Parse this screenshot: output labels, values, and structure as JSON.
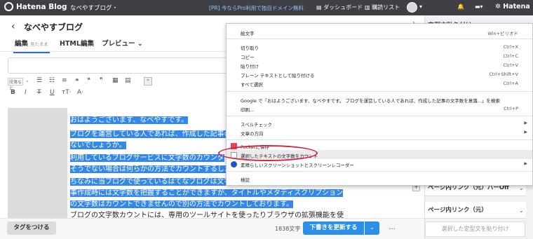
{
  "topbar": {
    "logo": "Hatena Blog",
    "blog_menu": "なべやすブログ・",
    "promo": "[PR] 今ならPro利用で独自ドメイン無料",
    "dashboard": "ダッシュボード",
    "reading_list": "購読リスト",
    "hatena": "Hatena"
  },
  "editor": {
    "blog_title": "なべやすブログ",
    "tabs": [
      {
        "label": "編集",
        "sub": "見たまま"
      },
      {
        "label": "HTML編集"
      },
      {
        "label": "プレビュー ⌄"
      }
    ],
    "font_size_label": "段落など"
  },
  "content": {
    "lines": [
      "おはようございます、なべやすです。",
      "ブログを運営している人であれば、作成した記事の文",
      "ないでしょうか。",
      "利用しているブログサービスに文字数のカウンタ",
      "そうでない場合は何らかの方法でカウントするしか",
      "ちなみに当ブログで使っているはてなブログは文字",
      "事作成時には文字数を把握することができますが、タイトルやメタディスクリプション",
      "の文字数はカウントできませんので別の方法でカウントしております。",
      "ブログの文字数カウントには、専用のツールサイトを使ったりブラウザの拡張機能を使"
    ]
  },
  "footer": {
    "tag_button": "タグをつける",
    "char_count": "1838文字",
    "save_button": "下書きを更新する",
    "save_arrow": "⌄",
    "more": "…"
  },
  "right_panel": {
    "title": "定型文貼り付け",
    "items": [
      "ページ内リンク（元）バーOff",
      "ページ内リンク（元）"
    ],
    "paste_button": "選択した定型文を貼り付け"
  },
  "context_menu": {
    "items": [
      {
        "label": "絵文字",
        "shortcut": "Win+ピリオド"
      },
      {
        "label": "切り取り",
        "shortcut": "Ctrl+X"
      },
      {
        "label": "コピー",
        "shortcut": "Ctrl+C"
      },
      {
        "label": "貼り付け",
        "shortcut": "Ctrl+V"
      },
      {
        "label": "プレーン テキストとして貼り付ける",
        "shortcut": "Ctrl+Shift+V"
      },
      {
        "label": "すべて選択",
        "shortcut": "Ctrl+A"
      },
      {
        "label": "Google で「おはようございます、なべやすです。 ブログを運営している人であれば、作成した記事の文字数を意識...」を検索",
        "shortcut": ""
      },
      {
        "label": "印刷...",
        "shortcut": "Ctrl+P"
      },
      {
        "label": "スペルチェック",
        "shortcut": ""
      },
      {
        "label": "文章の方向",
        "shortcut": ""
      },
      {
        "label": "Pocketに保存",
        "shortcut": ""
      },
      {
        "label": "選択したテキストの文字数をカウント",
        "shortcut": ""
      },
      {
        "label": "素晴らしいスクリーンショットとスクリーンレコーダー",
        "shortcut": ""
      },
      {
        "label": "検証",
        "shortcut": ""
      }
    ],
    "submenu_arrow": "▶",
    "highlight_color": "#d8213a"
  },
  "colors": {
    "accent": "#2b8fe7",
    "selection": "#3388e8",
    "topbar": "#3d3f44"
  }
}
